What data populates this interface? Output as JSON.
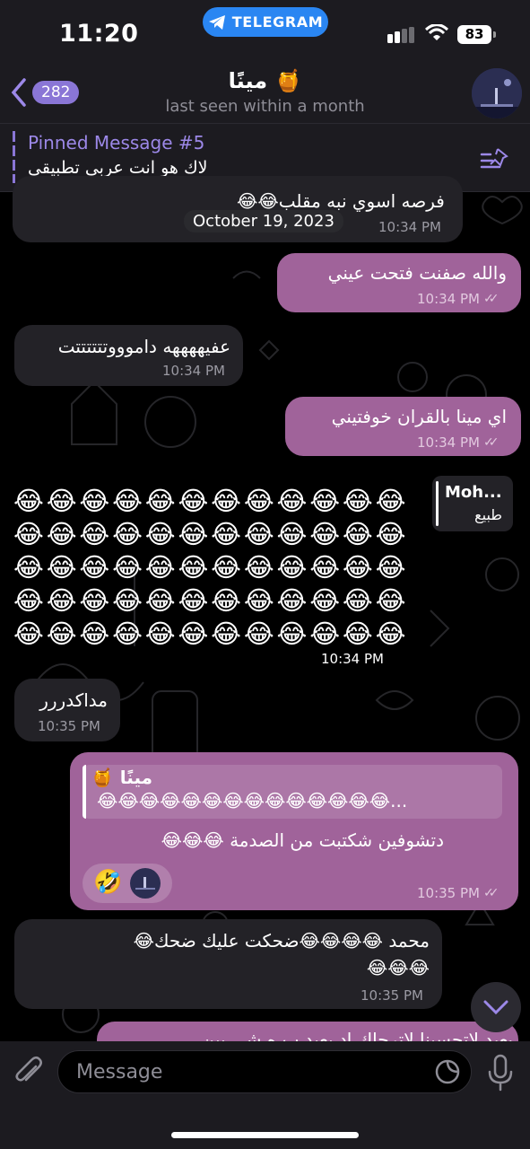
{
  "status_bar": {
    "time": "11:20",
    "app_pill": "TELEGRAM",
    "battery": "83"
  },
  "header": {
    "back_count": "282",
    "title": "مينًا 🍯",
    "subtitle": "last seen within a month",
    "avatar_icon": "night-scene-avatar"
  },
  "pinned": {
    "title": "Pinned Message #5",
    "text": "لاك هو انت عربي تطبيقي"
  },
  "date_chip": "October 19, 2023",
  "messages": [
    {
      "dir": "in",
      "text": "فرصه اسوي نبه مقلب😂😂",
      "time": "10:34 PM"
    },
    {
      "dir": "out",
      "text": "والله صفنت فتحت عيني",
      "time": "10:34 PM"
    },
    {
      "dir": "in",
      "text": "عفيههههه داموووتتتتتتت",
      "time": "10:34 PM"
    },
    {
      "dir": "out",
      "text": "اي مينا بالقران خوفتيني",
      "time": "10:34 PM"
    },
    {
      "dir": "in",
      "text": "مداكدررر",
      "time": "10:35 PM"
    },
    {
      "dir": "out",
      "text": "دتشوفين شكتبت من الصدمة 😂😂😂",
      "time": "10:35 PM",
      "reply_name": "مينًا 🍯",
      "reply_text": "😂😂😂😂😂😂😂😂😂😂😂😂😂😂...",
      "reactions": [
        "🤣"
      ]
    },
    {
      "dir": "in",
      "text": "محمد 😂😂😂😂ضحكت عليك ضحك😂",
      "text2": "😂😂😂",
      "time": "10:35 PM"
    },
    {
      "dir": "out",
      "text": "يعبد لاتحسبنا لاترجاك اد بعبد ب ه شي بين",
      "time": ""
    }
  ],
  "emoji_grid": {
    "emoji": "😂",
    "count": 60,
    "time": "10:34 PM",
    "reply_name": "Moh...",
    "reply_text": "طبيع"
  },
  "input": {
    "placeholder": "Message"
  },
  "colors": {
    "incoming": "#232227",
    "outgoing": "#a0639a",
    "accent": "#8a76d6",
    "bars": "#1c1b20"
  }
}
